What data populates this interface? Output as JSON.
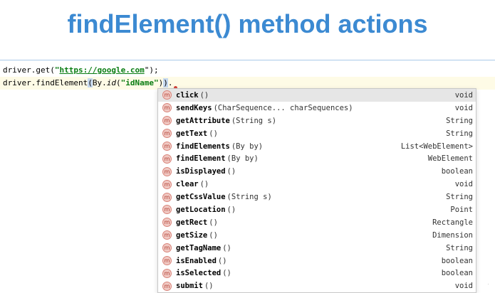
{
  "title": "findElement() method actions",
  "code": {
    "line1": {
      "prefix": "driver.get(",
      "open_quote": "\"",
      "url": "https://google.com",
      "close": "\");"
    },
    "line2": {
      "prefix": "driver.findElement",
      "open_paren": "(",
      "by": "By.",
      "by_method": "id",
      "arg_open": "(",
      "arg": "\"idName\"",
      "arg_close": ")",
      "close_paren": ")",
      "dot": "."
    }
  },
  "completion": {
    "icon_letter": "m",
    "items": [
      {
        "name": "click",
        "params": "()",
        "type": "void"
      },
      {
        "name": "sendKeys",
        "params": "(CharSequence... charSequences)",
        "type": "void"
      },
      {
        "name": "getAttribute",
        "params": "(String s)",
        "type": "String"
      },
      {
        "name": "getText",
        "params": "()",
        "type": "String"
      },
      {
        "name": "findElements",
        "params": "(By by)",
        "type": "List<WebElement>"
      },
      {
        "name": "findElement",
        "params": "(By by)",
        "type": "WebElement"
      },
      {
        "name": "isDisplayed",
        "params": "()",
        "type": "boolean"
      },
      {
        "name": "clear",
        "params": "()",
        "type": "void"
      },
      {
        "name": "getCssValue",
        "params": "(String s)",
        "type": "String"
      },
      {
        "name": "getLocation",
        "params": "()",
        "type": "Point"
      },
      {
        "name": "getRect",
        "params": "()",
        "type": "Rectangle"
      },
      {
        "name": "getSize",
        "params": "()",
        "type": "Dimension"
      },
      {
        "name": "getTagName",
        "params": "()",
        "type": "String"
      },
      {
        "name": "isEnabled",
        "params": "()",
        "type": "boolean"
      },
      {
        "name": "isSelected",
        "params": "()",
        "type": "boolean"
      },
      {
        "name": "submit",
        "params": "()",
        "type": "void"
      }
    ]
  },
  "colors": {
    "title": "#3c8ad2",
    "string_literal": "#0a7d12",
    "method_icon": "#b03a2e"
  }
}
